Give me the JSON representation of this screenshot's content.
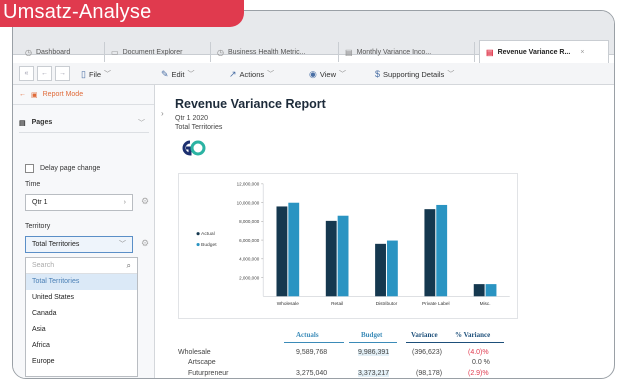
{
  "banner": {
    "title": "Umsatz-Analyse"
  },
  "tabs": [
    {
      "label": "Dashboard",
      "icon": "dashboard-icon"
    },
    {
      "label": "Document Explorer",
      "icon": "folder-icon"
    },
    {
      "label": "Business Health Metric...",
      "icon": "dashboard-icon"
    },
    {
      "label": "Monthly Variance Inco...",
      "icon": "report-icon"
    },
    {
      "label": "Revenue Variance R...",
      "icon": "report-icon",
      "active": true
    }
  ],
  "toolbar": {
    "file": "File",
    "edit": "Edit",
    "actions": "Actions",
    "view": "View",
    "supporting": "Supporting Details"
  },
  "sidebar": {
    "mode": "Report Mode",
    "pages": "Pages",
    "delay": "Delay page change",
    "time_label": "Time",
    "time_value": "Qtr 1",
    "territory_label": "Territory",
    "territory_value": "Total Territories",
    "search_placeholder": "Search",
    "options": [
      "Total Territories",
      "United States",
      "Canada",
      "Asia",
      "Africa",
      "Europe"
    ]
  },
  "report": {
    "title": "Revenue Variance Report",
    "period": "Qtr 1 2020",
    "scope": "Total Territories"
  },
  "chart_data": {
    "type": "bar",
    "categories": [
      "Wholesale",
      "Retail",
      "Distributor",
      "Private Label",
      "Misc."
    ],
    "series": [
      {
        "name": "Actual",
        "values": [
          9589768,
          8050000,
          5600000,
          9300000,
          1300000
        ],
        "color": "#15384f"
      },
      {
        "name": "Budget",
        "values": [
          9986391,
          8600000,
          5950000,
          9750000,
          1300000
        ],
        "color": "#2a94c2"
      }
    ],
    "yticks": [
      "12,000,000",
      "10,000,000",
      "8,000,000",
      "6,000,000",
      "4,000,000",
      "2,000,000"
    ],
    "ylim": [
      0,
      12000000
    ],
    "legend_position": "left"
  },
  "table": {
    "headers": [
      "Actuals",
      "Budget",
      "Variance",
      "% Variance"
    ],
    "rows": [
      {
        "label": "Wholesale",
        "actual": "9,589,768",
        "budget": "9,986,391",
        "variance": "(396,623)",
        "pct": "(4.0)%"
      },
      {
        "label": "Artscape",
        "actual": "",
        "budget": "",
        "variance": "",
        "pct": "0.0 %"
      },
      {
        "label": "Futurpreneur",
        "actual": "3,275,040",
        "budget": "3,373,217",
        "variance": "(98,178)",
        "pct": "(2.9)%"
      }
    ]
  }
}
